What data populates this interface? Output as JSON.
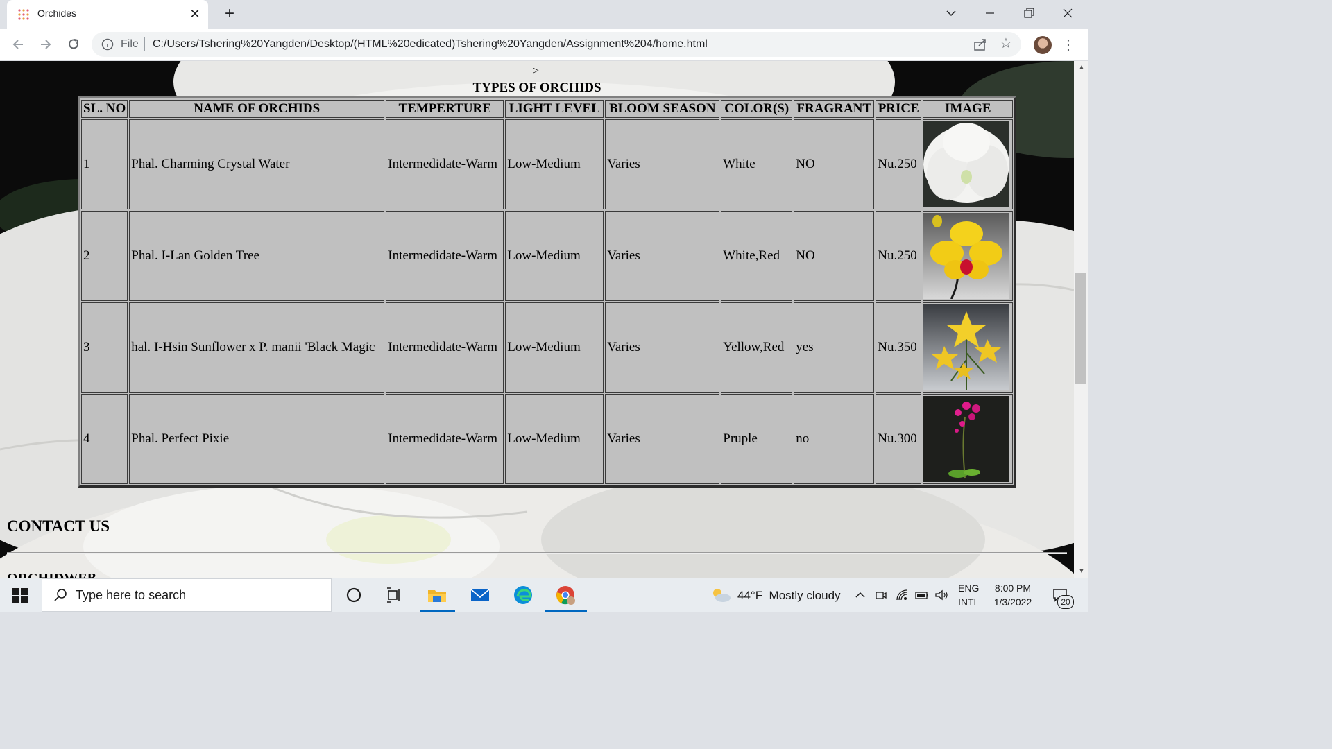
{
  "browser": {
    "tab_title": "Orchides",
    "new_tab_label": "+",
    "address_scheme": "File",
    "address_url": "C:/Users/Tshering%20Yangden/Desktop/(HTML%20edicated)Tshering%20Yangden/Assignment%204/home.html"
  },
  "page": {
    "stray_text": ">",
    "table_caption": "TYPES OF ORCHIDS",
    "headers": [
      "SL. NO",
      "NAME OF ORCHIDS",
      "TEMPERTURE",
      "LIGHT LEVEL",
      "BLOOM SEASON",
      "COLOR(S)",
      "FRAGRANT",
      "PRICE",
      "IMAGE"
    ],
    "rows": [
      {
        "sl": "1",
        "name": "Phal. Charming Crystal Water",
        "temperature": "Intermedidate-Warm",
        "light": "Low-Medium",
        "season": "Varies",
        "colors": "White",
        "fragrant": "NO",
        "price": "Nu.250",
        "image_icon": "white-orchid-photo"
      },
      {
        "sl": "2",
        "name": "Phal. I-Lan Golden Tree",
        "temperature": "Intermedidate-Warm",
        "light": "Low-Medium",
        "season": "Varies",
        "colors": "White,Red",
        "fragrant": "NO",
        "price": "Nu.250",
        "image_icon": "yellow-orchid-photo"
      },
      {
        "sl": "3",
        "name": "hal. I-Hsin Sunflower x P. manii 'Black Magic",
        "temperature": "Intermedidate-Warm",
        "light": "Low-Medium",
        "season": "Varies",
        "colors": "Yellow,Red",
        "fragrant": "yes",
        "price": "Nu.350",
        "image_icon": "yellow-orchid-cluster-photo"
      },
      {
        "sl": "4",
        "name": "Phal. Perfect Pixie",
        "temperature": "Intermedidate-Warm",
        "light": "Low-Medium",
        "season": "Varies",
        "colors": "Pruple",
        "fragrant": "no",
        "price": "Nu.300",
        "image_icon": "pink-orchid-photo"
      }
    ],
    "contact_heading": "CONTACT US",
    "cut_heading": "ORCHIDWEB"
  },
  "taskbar": {
    "search_placeholder": "Type here to search",
    "weather_temp": "44°F",
    "weather_desc": "Mostly cloudy",
    "lang_top": "ENG",
    "lang_bottom": "INTL",
    "time": "8:00 PM",
    "date": "1/3/2022",
    "notification_count": "20"
  },
  "colors": {
    "table_bg": "#c0c0c0",
    "accent": "#0067c0"
  }
}
